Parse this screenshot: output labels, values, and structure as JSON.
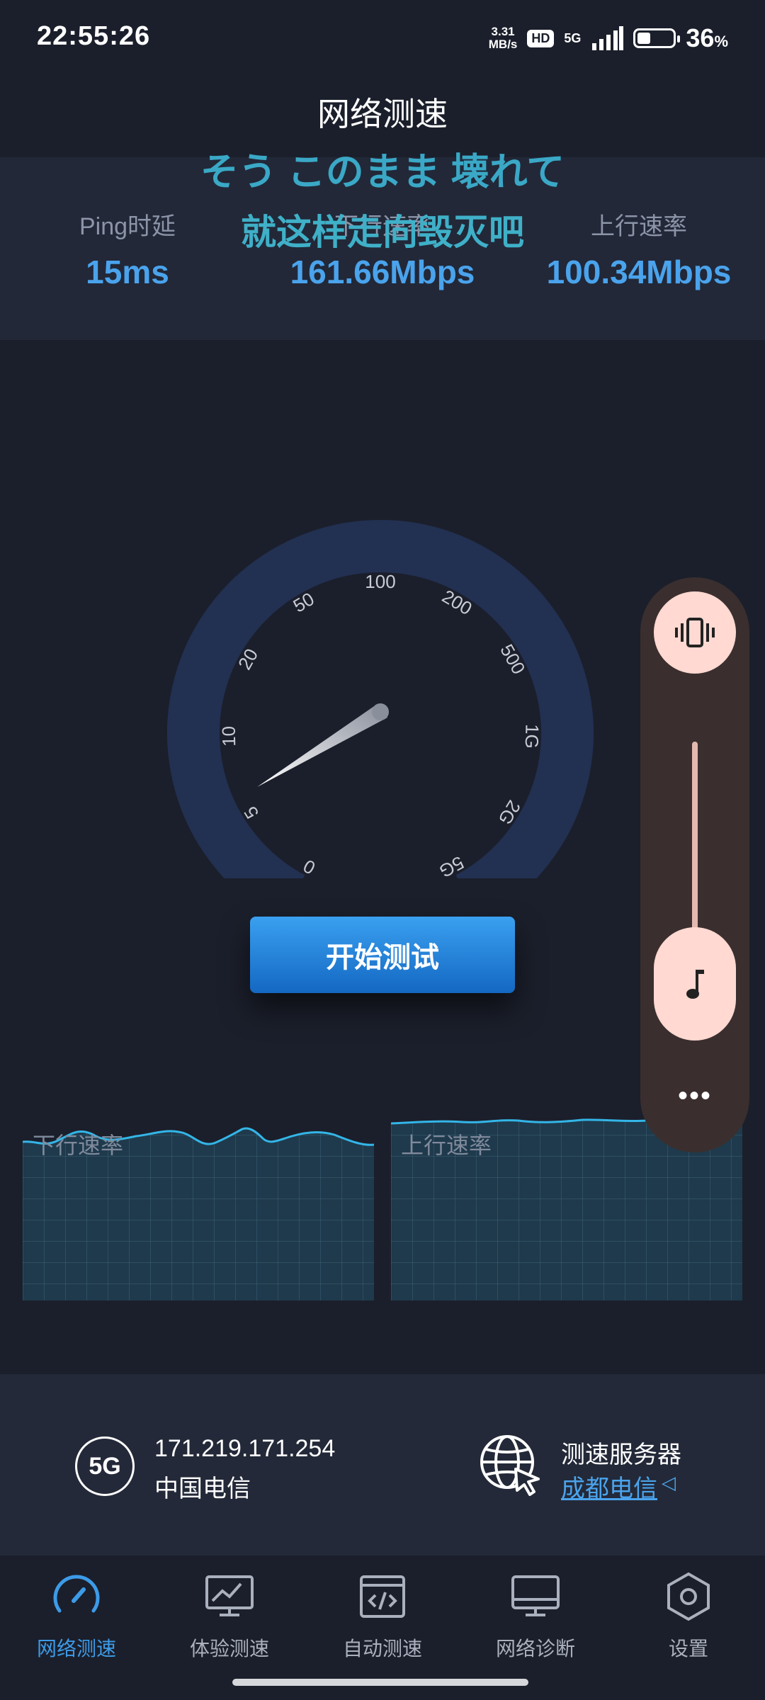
{
  "status_bar": {
    "time": "22:55:26",
    "net_speed_value": "3.31",
    "net_speed_unit": "MB/s",
    "hd": "HD",
    "network": "5G",
    "battery_percent": "36",
    "battery_unit": "%",
    "battery_level": 0.36
  },
  "header": {
    "title": "网络测速"
  },
  "lyrics": {
    "line1": "そう このまま 壊れて",
    "line2": "就这样走向毁灭吧"
  },
  "stats": {
    "ping": {
      "label": "Ping时延",
      "value": "15ms"
    },
    "download": {
      "label": "下行速率",
      "value": "161.66Mbps"
    },
    "upload": {
      "label": "上行速率",
      "value": "100.34Mbps"
    }
  },
  "gauge": {
    "ticks": [
      "0",
      "5",
      "10",
      "20",
      "50",
      "100",
      "200",
      "500",
      "1G",
      "2G",
      "5G"
    ]
  },
  "start_button": {
    "label": "开始测试"
  },
  "graphs": {
    "download_label": "下行速率",
    "upload_label": "上行速率"
  },
  "volume_panel": {
    "more": "•••"
  },
  "info": {
    "network_badge": "5G",
    "ip": "171.219.171.254",
    "isp": "中国电信",
    "server_label": "测速服务器",
    "server_name": "成都电信",
    "server_arrow": "◁"
  },
  "nav": {
    "items": [
      {
        "label": "网络测速",
        "icon": "speedometer-icon"
      },
      {
        "label": "体验测速",
        "icon": "chart-monitor-icon"
      },
      {
        "label": "自动测速",
        "icon": "code-window-icon"
      },
      {
        "label": "网络诊断",
        "icon": "monitor-icon"
      },
      {
        "label": "设置",
        "icon": "settings-hexagon-icon"
      }
    ]
  },
  "colors": {
    "background": "#1b1f2b",
    "accent": "#4aa3ec",
    "lyric": "#3aa8c6",
    "gauge_arc": "#223052",
    "button": "#1f7fd8"
  }
}
